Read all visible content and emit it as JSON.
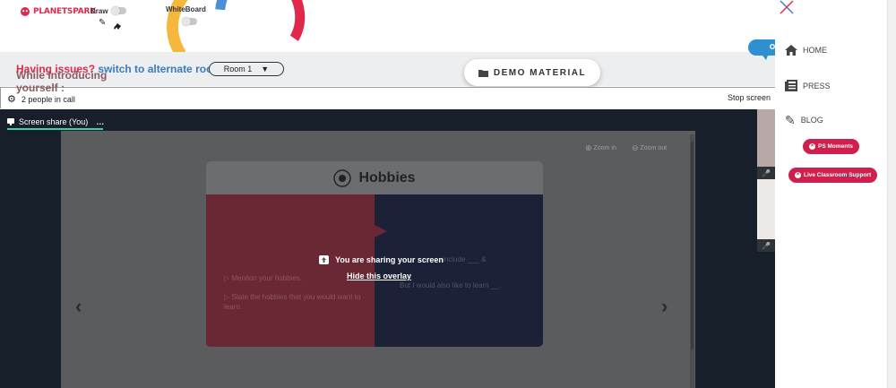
{
  "app": {
    "logo_text": "PLANETSPARK",
    "brand_color": "#e0284c"
  },
  "toolbar": {
    "draw_label": "Draw",
    "whiteboard_label": "WhiteBoard",
    "pencil_icon": "pencil-icon",
    "eraser_icon": "eraser-icon"
  },
  "banner": {
    "issue_text": "Having issues?",
    "switch_link": "switch to alternate room",
    "room_selected": "Room 1",
    "demo_button": "DEMO MATERIAL"
  },
  "call": {
    "people_text": "2 people in call",
    "stop_text": "Stop screen",
    "tab_label": "Screen share (You)",
    "tab_more": "…"
  },
  "share": {
    "zoom_in": "Zoom in",
    "zoom_out": "Zoom out",
    "sharing_msg": "You are sharing your screen",
    "hide_overlay": "Hide this overlay"
  },
  "slide": {
    "title": "Hobbies",
    "heading": "While Introducing yourself :",
    "bullets": [
      "Mention your hobbies.",
      "State the hobbies that you would want to learn."
    ],
    "right_line1": "include ___ &",
    "right_line2": "But I would also like to learn __."
  },
  "nav": {
    "items": [
      {
        "label": "HOME",
        "icon": "home-icon"
      },
      {
        "label": "PRESS",
        "icon": "newspaper-icon"
      },
      {
        "label": "BLOG",
        "icon": "pencil-icon"
      }
    ],
    "pill_moments": "PS Moments",
    "pill_support": "Live Classroom Support",
    "pill_color": "#d01f4d"
  }
}
